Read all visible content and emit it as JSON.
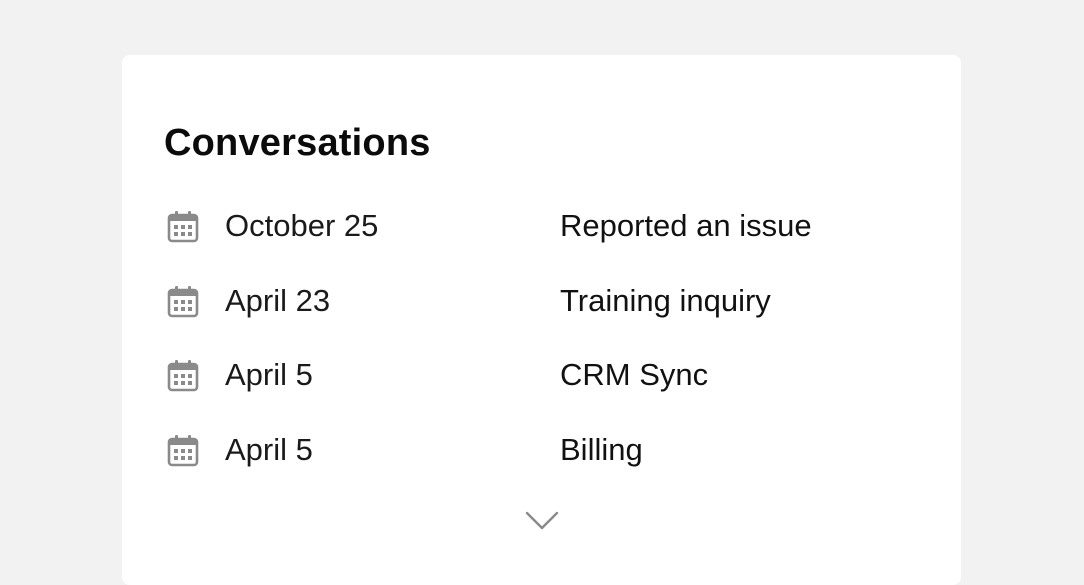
{
  "conversations": {
    "title": "Conversations",
    "items": [
      {
        "date": "October 25",
        "subject": "Reported an issue",
        "icon": "calendar-icon"
      },
      {
        "date": "April 23",
        "subject": "Training inquiry",
        "icon": "calendar-icon"
      },
      {
        "date": "April 5",
        "subject": "CRM Sync",
        "icon": "calendar-icon"
      },
      {
        "date": "April 5",
        "subject": "Billing",
        "icon": "calendar-icon"
      }
    ],
    "expand_icon": "chevron-down-icon"
  },
  "colors": {
    "background": "#f2f2f2",
    "card": "#ffffff",
    "icon": "#8a8a8a",
    "text": "#111111"
  }
}
